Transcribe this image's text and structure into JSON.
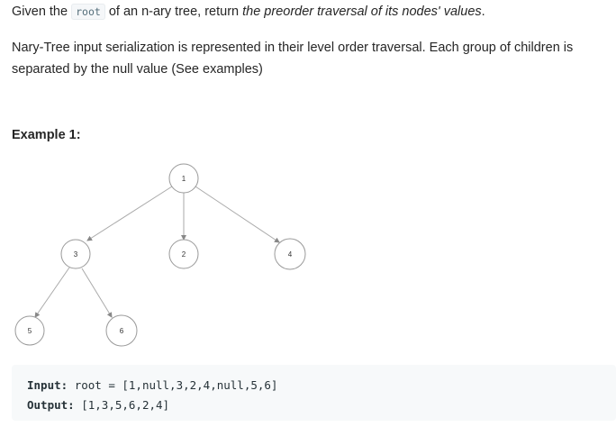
{
  "description": {
    "line1_prefix": "Given the ",
    "inline_code": "root",
    "line1_middle": " of an n-ary tree, return ",
    "line1_emphasis": "the preorder traversal of its nodes' values",
    "line1_suffix": ".",
    "paragraph2": "Nary-Tree input serialization is represented in their level order traversal. Each group of children is separated by the null value (See examples)"
  },
  "example": {
    "heading": "Example 1:",
    "tree_nodes": [
      "1",
      "3",
      "2",
      "4",
      "5",
      "6"
    ],
    "input_label": "Input:",
    "input_value": "root = [1,null,3,2,4,null,5,6]",
    "output_label": "Output:",
    "output_value": "[1,3,5,6,2,4]"
  },
  "colors": {
    "text": "#262626",
    "node_stroke": "#999999",
    "edge": "#aaaaaa",
    "code_bg": "#f7f9fa"
  }
}
